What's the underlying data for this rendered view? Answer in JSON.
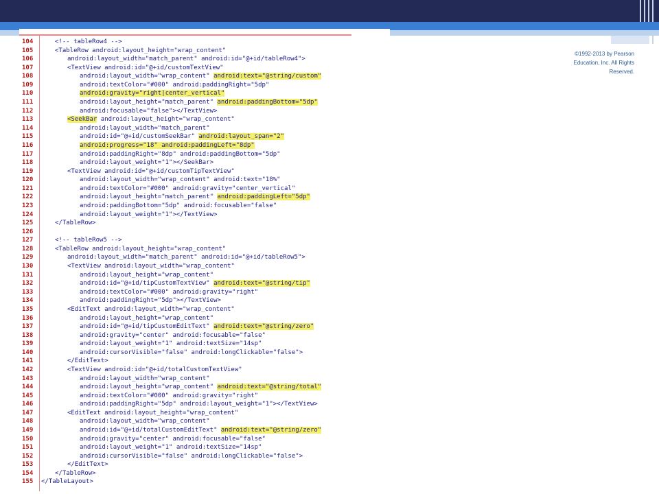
{
  "copyright": [
    "©1992-2013 by Pearson",
    "Education, Inc. All Rights",
    "Reserved."
  ],
  "code_lines": [
    {
      "n": "104",
      "segs": [
        {
          "t": "<!-- tableRow4 -->"
        }
      ],
      "indent": 1
    },
    {
      "n": "105",
      "segs": [
        {
          "t": "<TableRow android:layout_height=\"wrap_content\""
        }
      ],
      "indent": 1
    },
    {
      "n": "106",
      "segs": [
        {
          "t": "android:layout_width=\"match_parent\" android:id=\"@+id/tableRow4\">"
        }
      ],
      "indent": 2
    },
    {
      "n": "107",
      "segs": [
        {
          "t": "<TextView android:id=\"@+id/customTextView\""
        }
      ],
      "indent": 2
    },
    {
      "n": "108",
      "segs": [
        {
          "t": "android:layout_width=\"wrap_content\" "
        },
        {
          "t": "android:text=\"@string/custom\"",
          "hl": true
        }
      ],
      "indent": 3
    },
    {
      "n": "109",
      "segs": [
        {
          "t": "android:textColor=\"#000\" android:paddingRight=\"5dp\""
        }
      ],
      "indent": 3
    },
    {
      "n": "110",
      "segs": [
        {
          "t": "android:gravity=\"right|center_vertical\"",
          "hl": true
        }
      ],
      "indent": 3
    },
    {
      "n": "111",
      "segs": [
        {
          "t": "android:layout_height=\"match_parent\" "
        },
        {
          "t": "android:paddingBottom=\"5dp\"",
          "hl": true
        }
      ],
      "indent": 3
    },
    {
      "n": "112",
      "segs": [
        {
          "t": "android:focusable=\"false\"></TextView>"
        }
      ],
      "indent": 3
    },
    {
      "n": "113",
      "segs": [
        {
          "t": "<SeekBar",
          "hl": true
        },
        {
          "t": " android:layout_height=\"wrap_content\""
        }
      ],
      "indent": 2
    },
    {
      "n": "114",
      "segs": [
        {
          "t": "android:layout_width=\"match_parent\""
        }
      ],
      "indent": 3
    },
    {
      "n": "115",
      "segs": [
        {
          "t": "android:id=\"@+id/customSeekBar\" "
        },
        {
          "t": "android:layout_span=\"2\"",
          "hl": true
        }
      ],
      "indent": 3
    },
    {
      "n": "116",
      "segs": [
        {
          "t": "android:progress=\"18\" android:paddingLeft=\"8dp\"",
          "hl": true
        }
      ],
      "indent": 3
    },
    {
      "n": "117",
      "segs": [
        {
          "t": "android:paddingRight=\"8dp\" android:paddingBottom=\"5dp\""
        }
      ],
      "indent": 3
    },
    {
      "n": "118",
      "segs": [
        {
          "t": "android:layout_weight=\"1\"></SeekBar>"
        }
      ],
      "indent": 3
    },
    {
      "n": "119",
      "segs": [
        {
          "t": "<TextView android:id=\"@+id/customTipTextView\""
        }
      ],
      "indent": 2
    },
    {
      "n": "120",
      "segs": [
        {
          "t": "android:layout_width=\"wrap_content\" android:text=\"18%\""
        }
      ],
      "indent": 3
    },
    {
      "n": "121",
      "segs": [
        {
          "t": "android:textColor=\"#000\" android:gravity=\"center_vertical\""
        }
      ],
      "indent": 3
    },
    {
      "n": "122",
      "segs": [
        {
          "t": "android:layout_height=\"match_parent\" "
        },
        {
          "t": "android:paddingLeft=\"5dp\"",
          "hl": true
        }
      ],
      "indent": 3
    },
    {
      "n": "123",
      "segs": [
        {
          "t": "android:paddingBottom=\"5dp\" android:focusable=\"false\""
        }
      ],
      "indent": 3
    },
    {
      "n": "124",
      "segs": [
        {
          "t": "android:layout_weight=\"1\"></TextView>"
        }
      ],
      "indent": 3
    },
    {
      "n": "125",
      "segs": [
        {
          "t": "</TableRow>"
        }
      ],
      "indent": 1
    },
    {
      "n": "126",
      "segs": [
        {
          "t": ""
        }
      ],
      "indent": 0
    },
    {
      "n": "127",
      "segs": [
        {
          "t": "<!-- tableRow5 -->"
        }
      ],
      "indent": 1
    },
    {
      "n": "128",
      "segs": [
        {
          "t": "<TableRow android:layout_height=\"wrap_content\""
        }
      ],
      "indent": 1
    },
    {
      "n": "129",
      "segs": [
        {
          "t": "android:layout_width=\"match_parent\" android:id=\"@+id/tableRow5\">"
        }
      ],
      "indent": 2
    },
    {
      "n": "130",
      "segs": [
        {
          "t": "<TextView android:layout_width=\"wrap_content\""
        }
      ],
      "indent": 2
    },
    {
      "n": "131",
      "segs": [
        {
          "t": "android:layout_height=\"wrap_content\""
        }
      ],
      "indent": 3
    },
    {
      "n": "132",
      "segs": [
        {
          "t": "android:id=\"@+id/tipCustomTextView\" "
        },
        {
          "t": "android:text=\"@string/tip\"",
          "hl": true
        }
      ],
      "indent": 3
    },
    {
      "n": "133",
      "segs": [
        {
          "t": "android:textColor=\"#000\" android:gravity=\"right\""
        }
      ],
      "indent": 3
    },
    {
      "n": "134",
      "segs": [
        {
          "t": "android:paddingRight=\"5dp\"></TextView>"
        }
      ],
      "indent": 3
    },
    {
      "n": "135",
      "segs": [
        {
          "t": "<EditText android:layout_width=\"wrap_content\""
        }
      ],
      "indent": 2
    },
    {
      "n": "136",
      "segs": [
        {
          "t": "android:layout_height=\"wrap_content\""
        }
      ],
      "indent": 3
    },
    {
      "n": "137",
      "segs": [
        {
          "t": "android:id=\"@+id/tipCustomEditText\" "
        },
        {
          "t": "android:text=\"@string/zero\"",
          "hl": true
        }
      ],
      "indent": 3
    },
    {
      "n": "138",
      "segs": [
        {
          "t": "android:gravity=\"center\" android:focusable=\"false\""
        }
      ],
      "indent": 3
    },
    {
      "n": "139",
      "segs": [
        {
          "t": "android:layout_weight=\"1\" android:textSize=\"14sp\""
        }
      ],
      "indent": 3
    },
    {
      "n": "140",
      "segs": [
        {
          "t": "android:cursorVisible=\"false\" android:longClickable=\"false\">"
        }
      ],
      "indent": 3
    },
    {
      "n": "141",
      "segs": [
        {
          "t": "</EditText>"
        }
      ],
      "indent": 2
    },
    {
      "n": "142",
      "segs": [
        {
          "t": "<TextView android:id=\"@+id/totalCustomTextView\""
        }
      ],
      "indent": 2
    },
    {
      "n": "143",
      "segs": [
        {
          "t": "android:layout_width=\"wrap_content\""
        }
      ],
      "indent": 3
    },
    {
      "n": "144",
      "segs": [
        {
          "t": "android:layout_height=\"wrap_content\" "
        },
        {
          "t": "android:text=\"@string/total\"",
          "hl": true
        }
      ],
      "indent": 3
    },
    {
      "n": "145",
      "segs": [
        {
          "t": "android:textColor=\"#000\" android:gravity=\"right\""
        }
      ],
      "indent": 3
    },
    {
      "n": "146",
      "segs": [
        {
          "t": "android:paddingRight=\"5dp\" android:layout_weight=\"1\"></TextView>"
        }
      ],
      "indent": 3
    },
    {
      "n": "147",
      "segs": [
        {
          "t": "<EditText android:layout_height=\"wrap_content\""
        }
      ],
      "indent": 2
    },
    {
      "n": "148",
      "segs": [
        {
          "t": "android:layout_width=\"wrap_content\""
        }
      ],
      "indent": 3
    },
    {
      "n": "149",
      "segs": [
        {
          "t": "android:id=\"@+id/totalCustomEditText\" "
        },
        {
          "t": "android:text=\"@string/zero\"",
          "hl": true
        }
      ],
      "indent": 3
    },
    {
      "n": "150",
      "segs": [
        {
          "t": "android:gravity=\"center\" android:focusable=\"false\""
        }
      ],
      "indent": 3
    },
    {
      "n": "151",
      "segs": [
        {
          "t": "android:layout_weight=\"1\" android:textSize=\"14sp\""
        }
      ],
      "indent": 3
    },
    {
      "n": "152",
      "segs": [
        {
          "t": "android:cursorVisible=\"false\" android:longClickable=\"false\">"
        }
      ],
      "indent": 3
    },
    {
      "n": "153",
      "segs": [
        {
          "t": "</EditText>"
        }
      ],
      "indent": 2
    },
    {
      "n": "154",
      "segs": [
        {
          "t": "</TableRow>"
        }
      ],
      "indent": 1
    },
    {
      "n": "155",
      "segs": [
        {
          "t": "</TableLayout>"
        }
      ],
      "indent": 0
    }
  ]
}
